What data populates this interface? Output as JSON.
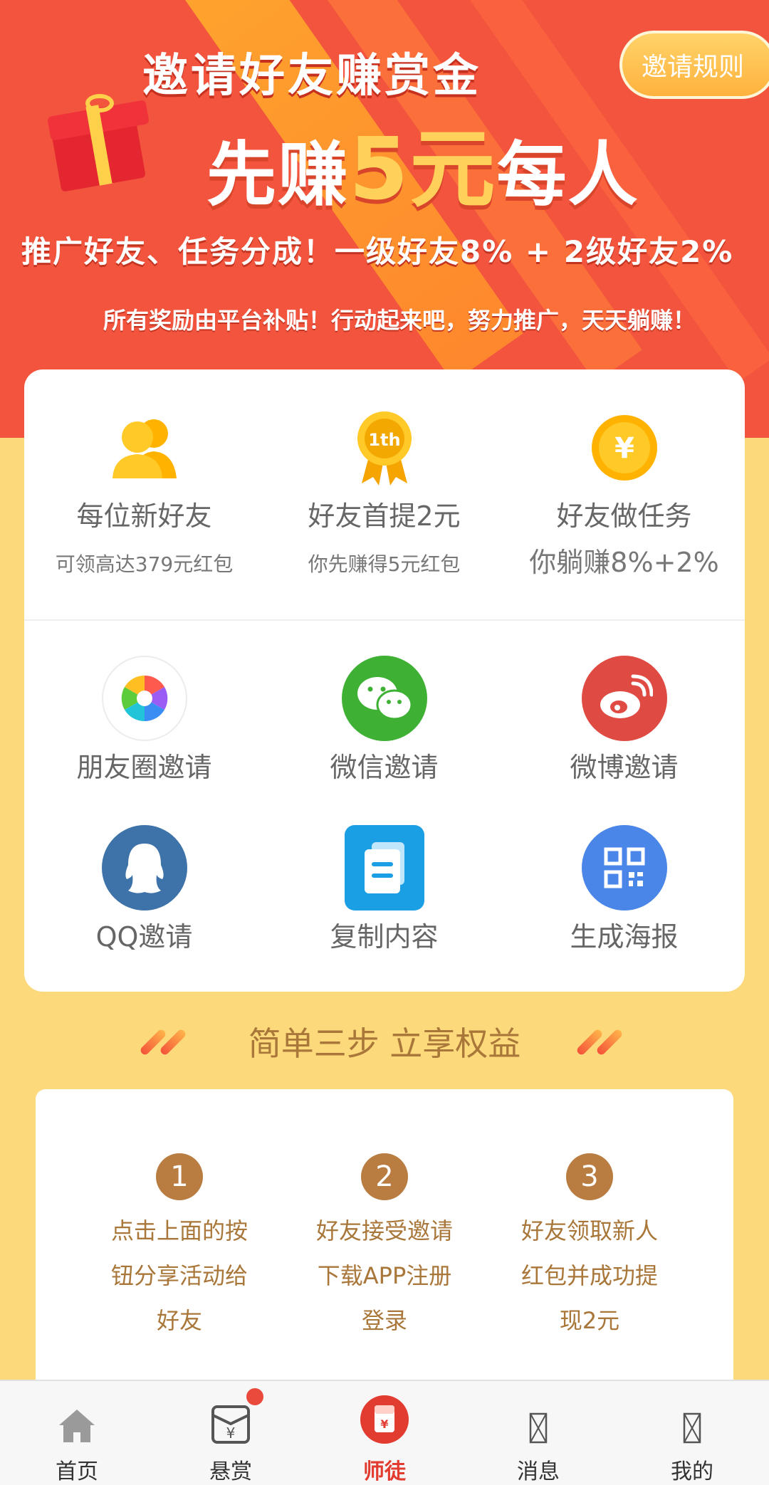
{
  "hero": {
    "rules_button": "邀请规则",
    "title": "邀请好友赚赏金",
    "sub_prefix": "先赚",
    "sub_amount": "5元",
    "sub_suffix": "每人",
    "line1": "推广好友、任务分成！一级好友8% + 2级好友2%",
    "line2": "所有奖励由平台补贴！行动起来吧，努力推广，天天躺赚！"
  },
  "perks": [
    {
      "title": "每位新好友",
      "desc": "可领高达379元红包",
      "icon": "users-icon"
    },
    {
      "title": "好友首提2元",
      "desc": "你先赚得5元红包",
      "icon": "medal-1th-icon",
      "badge_text": "1th"
    },
    {
      "title": "好友做任务",
      "desc": "你躺赚8%+2%",
      "icon": "yuan-coin-icon",
      "coin_symbol": "¥"
    }
  ],
  "share": [
    {
      "label": "朋友圈邀请",
      "icon": "moments-icon"
    },
    {
      "label": "微信邀请",
      "icon": "wechat-icon"
    },
    {
      "label": "微博邀请",
      "icon": "weibo-icon"
    },
    {
      "label": "QQ邀请",
      "icon": "qq-icon"
    },
    {
      "label": "复制内容",
      "icon": "copy-icon"
    },
    {
      "label": "生成海报",
      "icon": "qrcode-icon"
    }
  ],
  "steps_title": "简单三步 立享权益",
  "steps": [
    {
      "num": "1",
      "l1": "点击上面的按",
      "l2": "钮分享活动给",
      "l3": "好友"
    },
    {
      "num": "2",
      "l1": "好友接受邀请",
      "l2": "下载APP注册",
      "l3": "登录"
    },
    {
      "num": "3",
      "l1": "好友领取新人",
      "l2": "红包并成功提",
      "l3": "现2元"
    }
  ],
  "nav": [
    {
      "label": "首页",
      "icon": "home-icon"
    },
    {
      "label": "悬赏",
      "icon": "reward-envelope-icon",
      "badge": true,
      "symbol": "¥"
    },
    {
      "label": "师徒",
      "icon": "mentor-icon",
      "active": true,
      "symbol": "¥"
    },
    {
      "label": "消息",
      "icon": "message-icon"
    },
    {
      "label": "我的",
      "icon": "profile-icon"
    }
  ],
  "colors": {
    "hero_bg": "#f2543e",
    "page_bg": "#fcd97a",
    "accent_brown": "#a9773a",
    "active_red": "#e23b2f"
  }
}
